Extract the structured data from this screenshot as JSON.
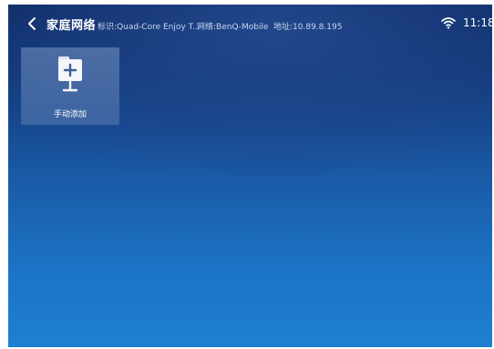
{
  "header": {
    "title": "家庭网络",
    "identifier": "标识:Quad-Core Enjoy T...",
    "network": "网络:BenQ-Mobile",
    "address": "地址:10.89.8.195"
  },
  "status": {
    "time": "11:18",
    "wifi_icon": "wifi-icon"
  },
  "tiles": [
    {
      "label": "手动添加",
      "icon": "add-folder-icon"
    }
  ],
  "colors": {
    "background_top": "#0e2a63",
    "background_bottom": "#1f7fd2",
    "tile_background": "#7896c3",
    "text": "#ffffff",
    "info_text": "#c8d6ee"
  }
}
